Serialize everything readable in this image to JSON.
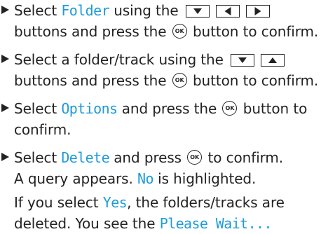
{
  "steps": [
    {
      "line1_pre": "Select ",
      "line1_kw": "Folder",
      "line1_post": " using the",
      "line2_a": "buttons and press the ",
      "line2_b": " button to confirm."
    },
    {
      "line1_pre": "Select a folder/track using the",
      "line2_a": "buttons and press the ",
      "line2_b": " button to confirm."
    },
    {
      "line1_pre": "Select ",
      "line1_kw": "Options",
      "line1_mid": " and press the ",
      "line1_post": " button to",
      "line2_a": "confirm."
    },
    {
      "line1_pre": "Select ",
      "line1_kw": "Delete",
      "line1_mid": " and press ",
      "line1_post": " to confirm.",
      "line2_a": "A query appears. ",
      "line2_kw": "No",
      "line2_b": " is highlighted.",
      "line3_a": "If you select ",
      "line3_kw": "Yes",
      "line3_b": ", the folders/tracks are",
      "line4_a": "deleted. You see the ",
      "line4_kw": "Please Wait..."
    }
  ],
  "ok_label": "OK",
  "colors": {
    "text": "#222222",
    "keyword": "#1f9bd9"
  },
  "icons": {
    "bullet": "triangle-right-icon",
    "down": "arrow-down-icon",
    "up": "arrow-up-icon",
    "left": "arrow-left-icon",
    "right": "arrow-right-icon",
    "ok": "ok-button-icon"
  }
}
